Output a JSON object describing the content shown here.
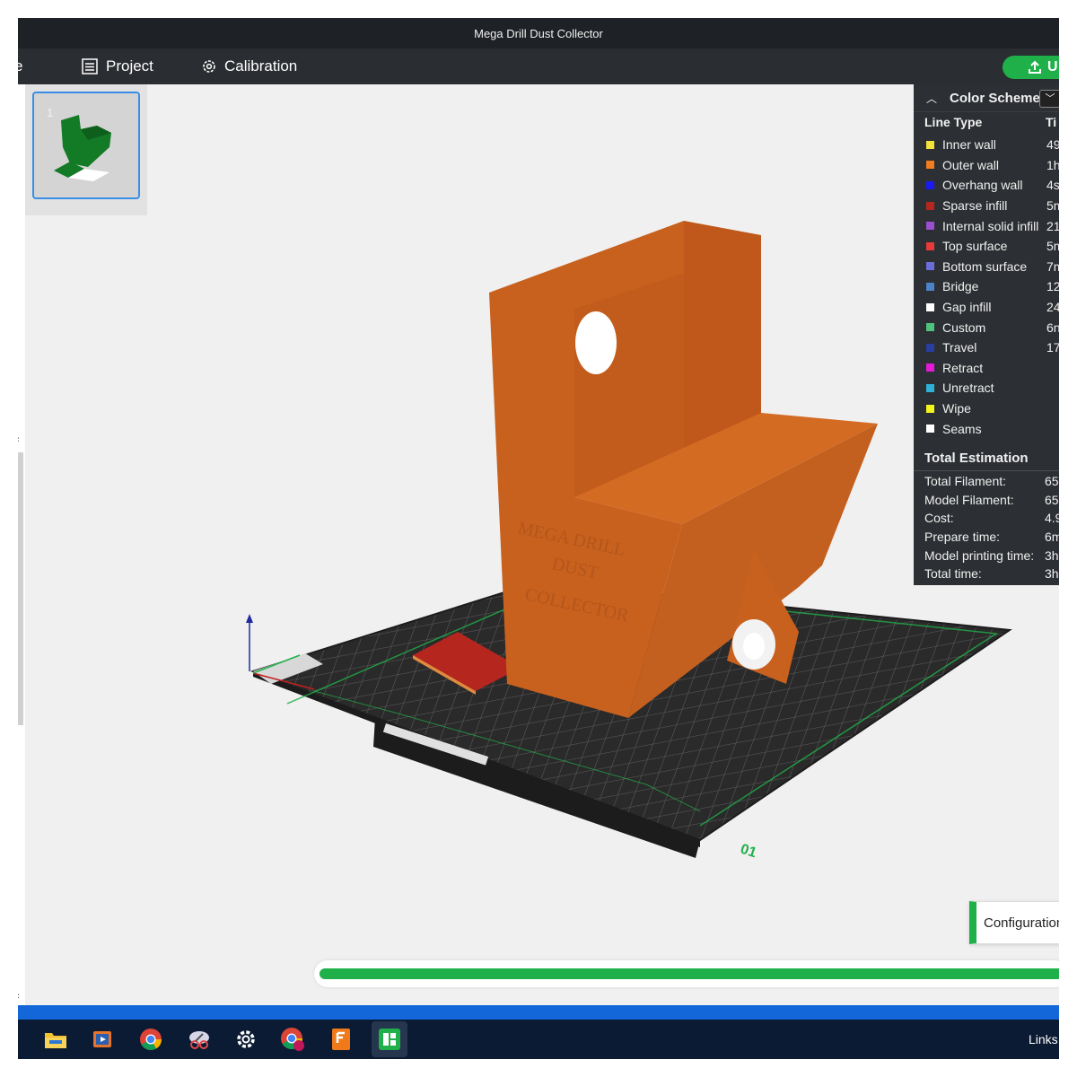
{
  "window": {
    "title": "Mega Drill Dust Collector"
  },
  "toolbar": {
    "cut_label": "e",
    "project_label": "Project",
    "calibration_label": "Calibration",
    "upload_label": "U"
  },
  "plate_list": {
    "plate_number": "1"
  },
  "legend": {
    "title": "Color Scheme",
    "col_line_type": "Line Type",
    "col_time": "Ti",
    "items": [
      {
        "label": "Inner wall",
        "time": "49",
        "color": "#f5e23a"
      },
      {
        "label": "Outer wall",
        "time": "1h",
        "color": "#f27d1e"
      },
      {
        "label": "Overhang wall",
        "time": "4s",
        "color": "#1a1af5"
      },
      {
        "label": "Sparse infill",
        "time": "5m",
        "color": "#b5261e"
      },
      {
        "label": "Internal solid infill",
        "time": "21",
        "color": "#9a4fd0"
      },
      {
        "label": "Top surface",
        "time": "5m",
        "color": "#e93a3a"
      },
      {
        "label": "Bottom surface",
        "time": "7m",
        "color": "#6a6ed8"
      },
      {
        "label": "Bridge",
        "time": "12",
        "color": "#4d84c9"
      },
      {
        "label": "Gap infill",
        "time": "24",
        "color": "#ffffff"
      },
      {
        "label": "Custom",
        "time": "6n",
        "color": "#4fc27d"
      },
      {
        "label": "Travel",
        "time": "17",
        "color": "#2a3da1"
      },
      {
        "label": "Retract",
        "time": "",
        "color": "#e31ad8"
      },
      {
        "label": "Unretract",
        "time": "",
        "color": "#2fb0d8"
      },
      {
        "label": "Wipe",
        "time": "",
        "color": "#f5f51e"
      },
      {
        "label": "Seams",
        "time": "",
        "color": "#ffffff"
      }
    ],
    "totals_title": "Total Estimation",
    "totals": [
      {
        "label": "Total Filament:",
        "value": "65"
      },
      {
        "label": "Model Filament:",
        "value": "65"
      },
      {
        "label": "Cost:",
        "value": "4.9"
      },
      {
        "label": "Prepare time:",
        "value": "6m"
      },
      {
        "label": "Model printing time:",
        "value": "3h"
      },
      {
        "label": "Total time:",
        "value": "3h"
      }
    ]
  },
  "model": {
    "embossed_text_lines": [
      "MEGA DRILL",
      "DUST",
      "COLLECTOR"
    ],
    "plate_label": "01",
    "color": "#c8601e"
  },
  "notification": {
    "text": "Configuration"
  },
  "progress": {
    "fraction": 1.0
  },
  "taskbar": {
    "icons": [
      "file-explorer-icon",
      "media-player-icon",
      "chrome-icon",
      "snipping-tool-icon",
      "settings-icon",
      "chrome-profile-icon",
      "fusion-icon",
      "bambu-studio-icon"
    ],
    "links_label": "Links"
  }
}
